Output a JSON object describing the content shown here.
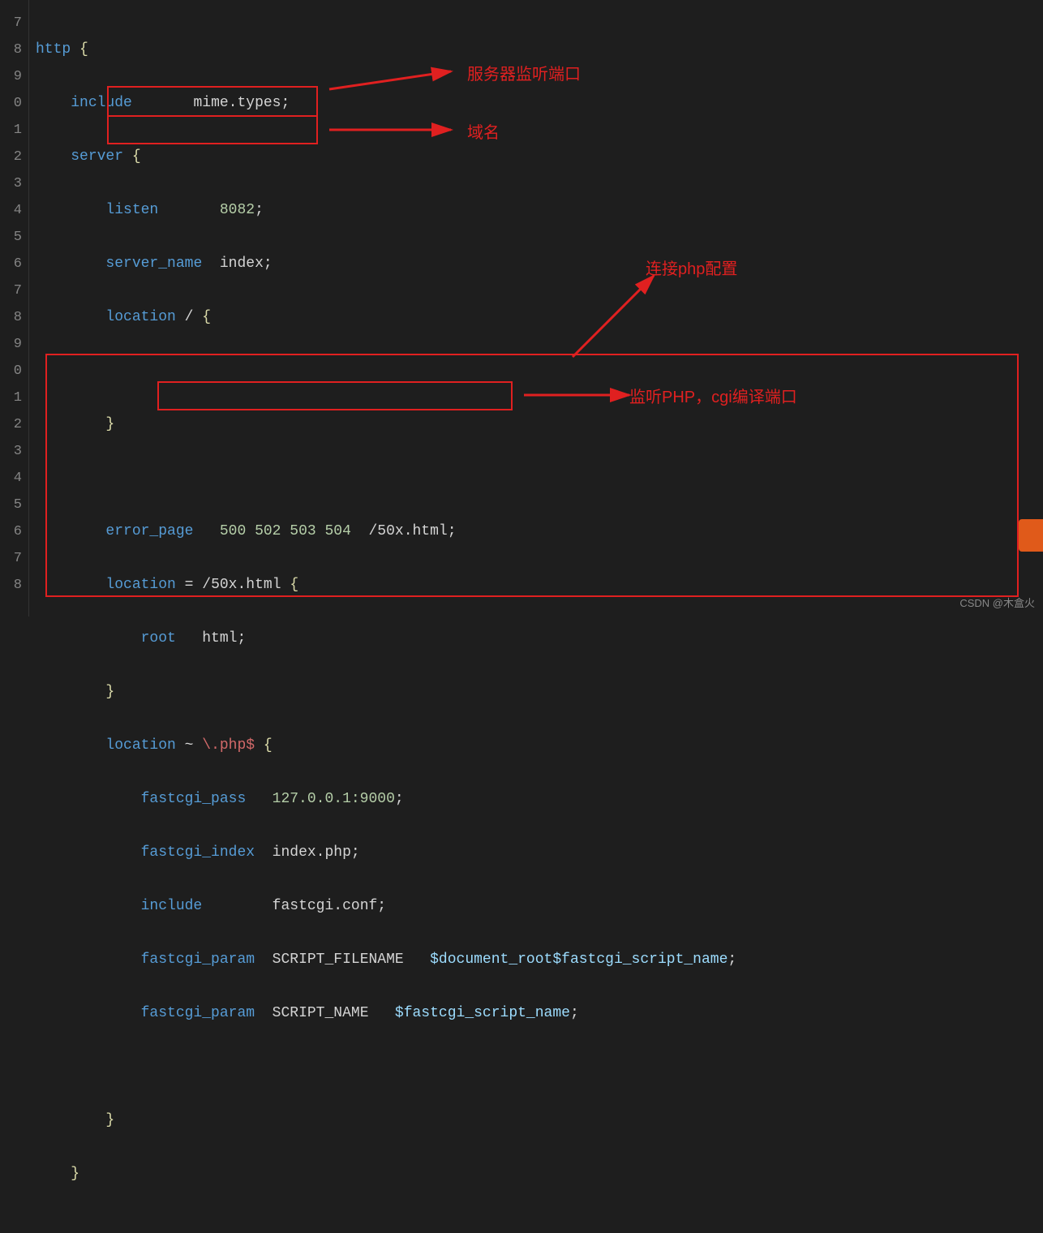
{
  "gutter": [
    "7",
    "8",
    "9",
    "0",
    "1",
    "2",
    "3",
    "4",
    "5",
    "6",
    "7",
    "8",
    "9",
    "0",
    "1",
    "2",
    "3",
    "4",
    "5",
    "6",
    "7",
    "8"
  ],
  "code": {
    "l1": {
      "http": "http",
      "brace": "{"
    },
    "l2": {
      "include": "include",
      "val": "mime.types",
      "semi": ";"
    },
    "l3": {
      "server": "server",
      "brace": "{"
    },
    "l4": {
      "listen": "listen",
      "port": "8082",
      "semi": ";"
    },
    "l5": {
      "sname": "server_name",
      "val": "index",
      "semi": ";"
    },
    "l6": {
      "loc": "location",
      "path": "/",
      "brace": "{"
    },
    "l7": {
      "brace": "}"
    },
    "l8": {
      "ep": "error_page",
      "codes": "500 502 503 504",
      "path": "/50x.html",
      "semi": ";"
    },
    "l9": {
      "loc": "location",
      "eq": "=",
      "path": "/50x.html",
      "brace": "{"
    },
    "l10": {
      "root": "root",
      "val": "html",
      "semi": ";"
    },
    "l11": {
      "brace": "}"
    },
    "l12": {
      "loc": "location",
      "tilde": "~",
      "rx": "\\.php$",
      "brace": "{"
    },
    "l13": {
      "fp": "fastcgi_pass",
      "addr": "127.0.0.1:9000",
      "semi": ";"
    },
    "l14": {
      "fi": "fastcgi_index",
      "val": "index.php",
      "semi": ";"
    },
    "l15": {
      "inc": "include",
      "val": "fastcgi.conf",
      "semi": ";"
    },
    "l16": {
      "fpm": "fastcgi_param",
      "key": "SCRIPT_FILENAME",
      "v1": "$document_root",
      "v2": "$fastcgi_script_name",
      "semi": ";"
    },
    "l17": {
      "fpm": "fastcgi_param",
      "key": "SCRIPT_NAME",
      "v": "$fastcgi_script_name",
      "semi": ";"
    },
    "l18": {
      "brace": "}"
    },
    "l19": {
      "brace": "}"
    }
  },
  "annotations": {
    "a1": "服务器监听端口",
    "a2": "域名",
    "a3": "连接php配置",
    "a4": "监听PHP，cgi编译端口"
  },
  "watermark": "CSDN @木盒火"
}
